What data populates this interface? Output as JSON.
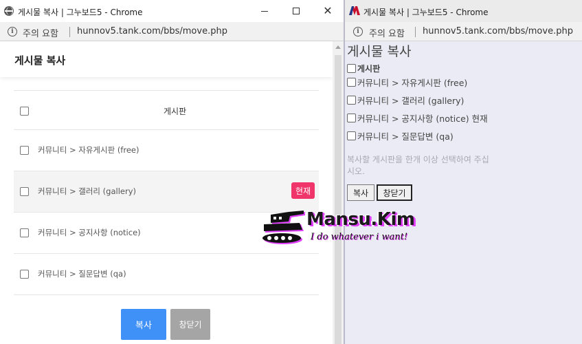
{
  "left_window": {
    "title": "게시물 복사 | 그누보드5 - Chrome",
    "security_label": "주의 요함",
    "url": "hunnov5.tank.com/bbs/move.php",
    "modal_title": "게시물 복사",
    "table": {
      "header": "게시판",
      "rows": [
        {
          "label": "커뮤니티 > 자유게시판 (free)",
          "current": false
        },
        {
          "label": "커뮤니티 > 갤러리 (gallery)",
          "current": true
        },
        {
          "label": "커뮤니티 > 공지사항 (notice)",
          "current": false
        },
        {
          "label": "커뮤니티 > 질문답변 (qa)",
          "current": false
        }
      ],
      "current_badge": "현재"
    },
    "buttons": {
      "copy": "복사",
      "close": "창닫기"
    }
  },
  "right_window": {
    "title": "게시물 복사 | 그누보드5 - Chrome",
    "security_label": "주의 요함",
    "url": "hunnov5.tank.com/bbs/move.php",
    "heading": "게시물 복사",
    "header": "게시판",
    "rows": [
      "커뮤니티 > 자유게시판 (free)",
      "커뮤니티 > 갤러리 (gallery)",
      "커뮤니티 > 공지사항 (notice) 현재",
      "커뮤니티 > 질문답변 (qa)"
    ],
    "message": "복사할 게시판을 한개 이상 선택하여 주십시오.",
    "buttons": {
      "copy": "복사",
      "close": "창닫기"
    }
  },
  "watermark": {
    "name": "Mansu.Kim",
    "slogan": "I do whatever i want!"
  },
  "colors": {
    "primary_button": "#3f91f7",
    "secondary_button": "#a5a5a5",
    "current_badge": "#f0356b",
    "right_background": "#ebebf5",
    "watermark_accent": "#e040fb"
  },
  "icons": {
    "left_title": "globe-icon",
    "right_title": "app-logo-icon",
    "security": "info-icon"
  }
}
